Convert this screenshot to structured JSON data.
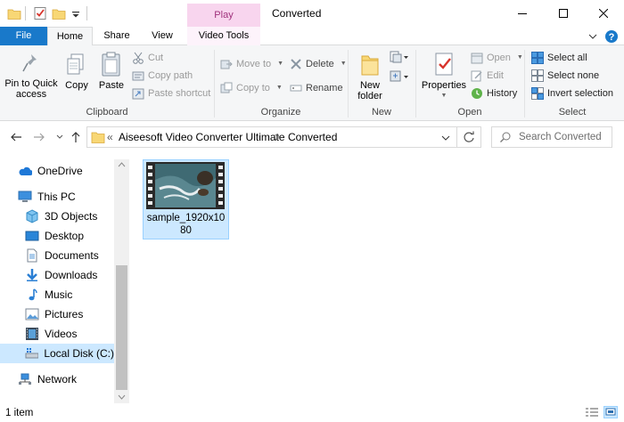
{
  "window": {
    "context_tab": "Play",
    "title": "Converted"
  },
  "ribbon": {
    "tabs": {
      "file": "File",
      "home": "Home",
      "share": "Share",
      "view": "View",
      "video_tools": "Video Tools"
    },
    "clipboard": {
      "pin_line1": "Pin to Quick",
      "pin_line2": "access",
      "copy": "Copy",
      "paste": "Paste",
      "cut": "Cut",
      "copy_path": "Copy path",
      "paste_shortcut": "Paste shortcut",
      "label": "Clipboard"
    },
    "organize": {
      "move_to": "Move to",
      "copy_to": "Copy to",
      "delete": "Delete",
      "rename": "Rename",
      "label": "Organize"
    },
    "new": {
      "new_folder_line1": "New",
      "new_folder_line2": "folder",
      "label": "New"
    },
    "open": {
      "properties": "Properties",
      "open": "Open",
      "edit": "Edit",
      "history": "History",
      "label": "Open"
    },
    "select": {
      "select_all": "Select all",
      "select_none": "Select none",
      "invert": "Invert selection",
      "label": "Select"
    }
  },
  "address": {
    "overflow": "«",
    "crumb1": "Aiseesoft Video Converter Ultimate",
    "crumb2": "Converted",
    "separator": ">",
    "search_placeholder": "Search Converted"
  },
  "nav": {
    "onedrive": "OneDrive",
    "this_pc": "This PC",
    "objects3d": "3D Objects",
    "desktop": "Desktop",
    "documents": "Documents",
    "downloads": "Downloads",
    "music": "Music",
    "pictures": "Pictures",
    "videos": "Videos",
    "local_disk": "Local Disk (C:)",
    "network": "Network"
  },
  "files": [
    {
      "name": "sample_1920x1080"
    }
  ],
  "status": {
    "count": "1 item"
  },
  "colors": {
    "accent": "#1979ca",
    "selection": "#cce8ff",
    "play_context": "#f8d5ee"
  }
}
